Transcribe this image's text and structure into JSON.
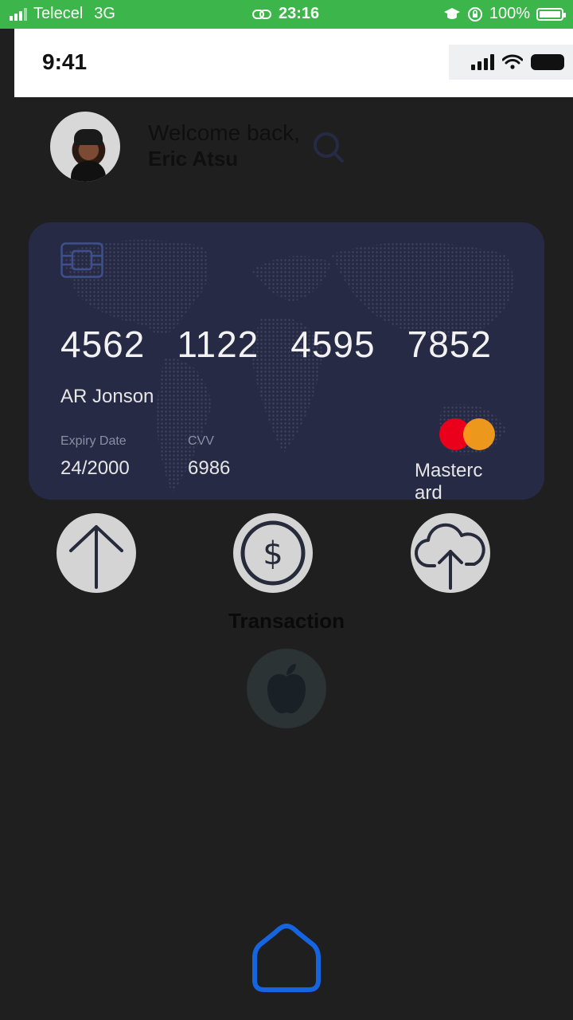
{
  "system_status": {
    "carrier": "Telecel",
    "network": "3G",
    "time": "23:16",
    "battery": "100%",
    "color": "#3cb54a"
  },
  "ios_status": {
    "time": "9:41"
  },
  "header": {
    "welcome": "Welcome back,",
    "user_name": "Eric Atsu"
  },
  "card": {
    "number_groups": [
      "4562",
      "1122",
      "4595",
      "7852"
    ],
    "holder_name": "AR Jonson",
    "expiry_label": "Expiry Date",
    "expiry_value": "24/2000",
    "cvv_label": "CVV",
    "cvv_value": "6986",
    "brand": "Masterc ard",
    "colors": {
      "background": "#262a44",
      "mc_red": "#eb001b",
      "mc_orange": "#f79e1b"
    }
  },
  "actions": {
    "items": [
      {
        "icon": "arrow-up-icon"
      },
      {
        "icon": "dollar-coin-icon"
      },
      {
        "icon": "cloud-upload-icon"
      }
    ],
    "section_label": "Transaction",
    "apple_icon": "apple-icon"
  },
  "bottom_nav": {
    "home_icon": "home-icon",
    "accent": "#1565e0"
  }
}
